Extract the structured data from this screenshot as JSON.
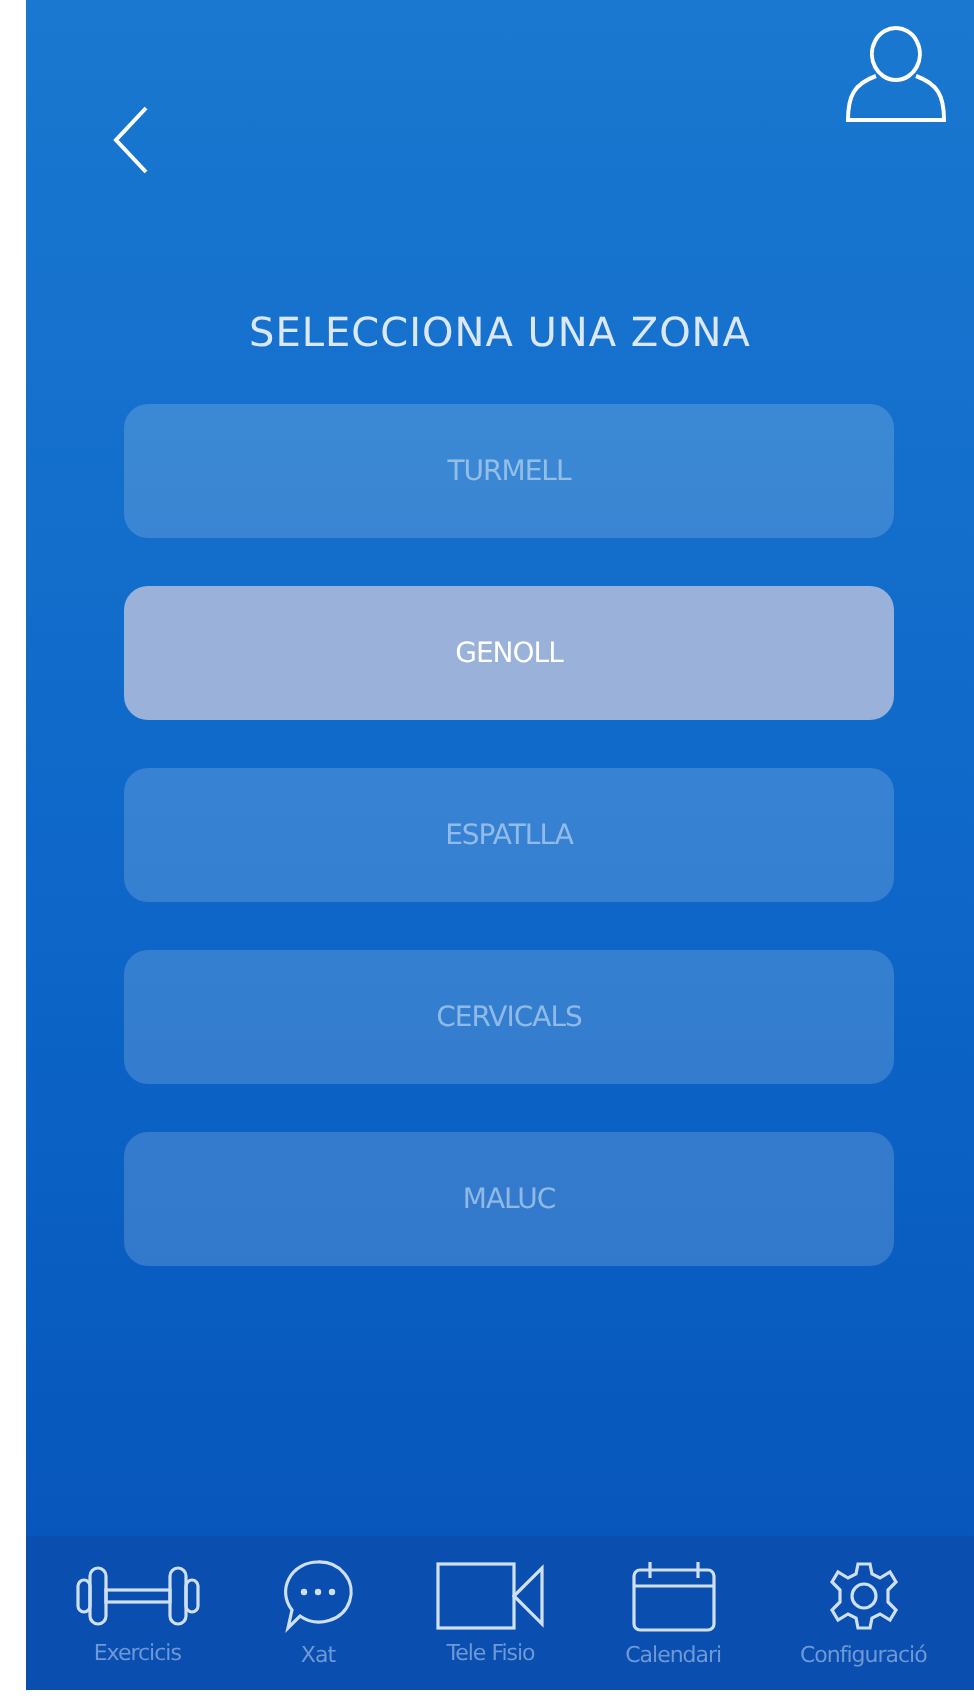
{
  "title": "SELECCIONA UNA ZONA",
  "zones": [
    {
      "label": "TURMELL",
      "selected": false
    },
    {
      "label": "GENOLL",
      "selected": true
    },
    {
      "label": "ESPATLLA",
      "selected": false
    },
    {
      "label": "CERVICALS",
      "selected": false
    },
    {
      "label": "MALUC",
      "selected": false
    }
  ],
  "nav": [
    {
      "label": "Exercicis"
    },
    {
      "label": "Xat"
    },
    {
      "label": "Tele Fisio"
    },
    {
      "label": "Calendari"
    },
    {
      "label": "Configuració"
    }
  ]
}
